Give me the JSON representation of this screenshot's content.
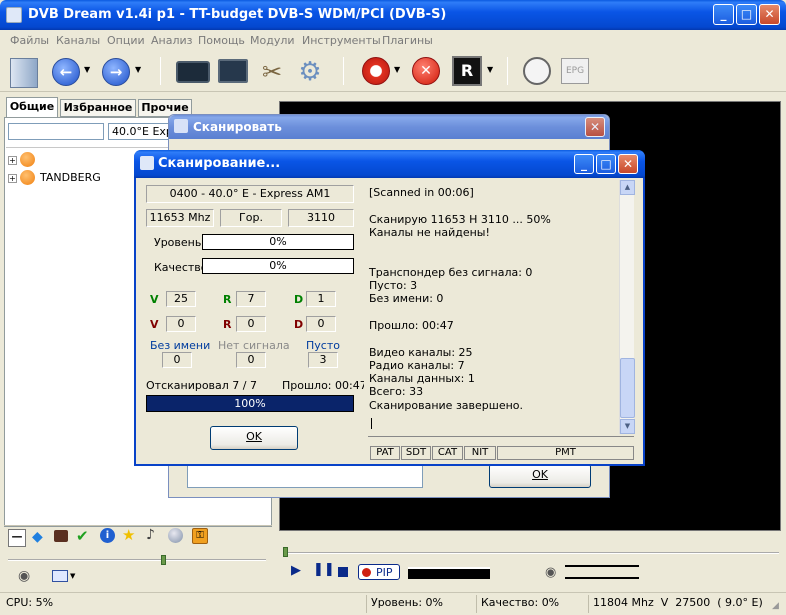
{
  "window": {
    "title": "DVB Dream v1.4i p1 - TT-budget DVB-S WDM/PCI (DVB-S)"
  },
  "menu": [
    "Файлы",
    "Каналы",
    "Опции",
    "Анализ",
    "Помощь",
    "Модули",
    "Инструменты",
    "Плагины"
  ],
  "left_panel": {
    "tabs": [
      "Общие",
      "Избранное",
      "Прочие"
    ],
    "filter_value": "",
    "satellite_value": "40.0°E Express",
    "tree": [
      {
        "label": ""
      },
      {
        "label": "TANDBERG"
      }
    ]
  },
  "bg_dialog": {
    "title": "Сканировать",
    "ok_label": "OK"
  },
  "scan": {
    "title": "Сканирование...",
    "satellite": "0400 - 40.0° E - Express AM1",
    "frequency": "11653 Mhz",
    "polarization": "Гор.",
    "symbol_rate": "3110",
    "level_label": "Уровень",
    "level_value": "0%",
    "quality_label": "Качество",
    "quality_value": "0%",
    "counters": {
      "v_label": "V",
      "r_label": "R",
      "d_label": "D",
      "v_found": "25",
      "r_found": "7",
      "d_found": "1",
      "v_new": "0",
      "r_new": "0",
      "d_new": "0"
    },
    "noname_label": "Без имени",
    "noname_value": "0",
    "nosignal_label": "Нет сигнала",
    "nosignal_value": "0",
    "empty_label": "Пусто",
    "empty_value": "3",
    "scanned_text": "Отсканировал 7 / 7",
    "elapsed_text": "Прошло: 00:47",
    "progress_text": "100%",
    "progress_fraction": 1.0,
    "ok_label": "OK",
    "log": [
      "[Scanned in 00:06]",
      "",
      "Сканирую 11653 H 3110 ... 50%",
      "Каналы не найдены!",
      "",
      "",
      "Транспондер без сигнала: 0",
      "Пусто: 3",
      "Без имени: 0",
      "",
      "Прошло: 00:47",
      "",
      "Видео каналы: 25",
      "Радио каналы: 7",
      "Каналы данных: 1",
      "Всего: 33",
      "Сканирование завершено."
    ],
    "table_tabs": [
      "PAT",
      "SDT",
      "CAT",
      "NIT",
      "PMT"
    ]
  },
  "player": {
    "pip_label": "PIP"
  },
  "statusbar": {
    "cpu": "CPU: 5%",
    "level": "Уровень: 0%",
    "quality": "Качество: 0%",
    "tuning": "11804 Mhz  V  27500  ( 9.0° E)"
  },
  "colors": {
    "title_active": "#0a55e6",
    "progress": "#0a246a",
    "v": "#008000",
    "r": "#008000",
    "d": "#008000",
    "v_new": "#800000",
    "r_new": "#800000",
    "d_new": "#800000",
    "label_blue": "#003c9e"
  }
}
